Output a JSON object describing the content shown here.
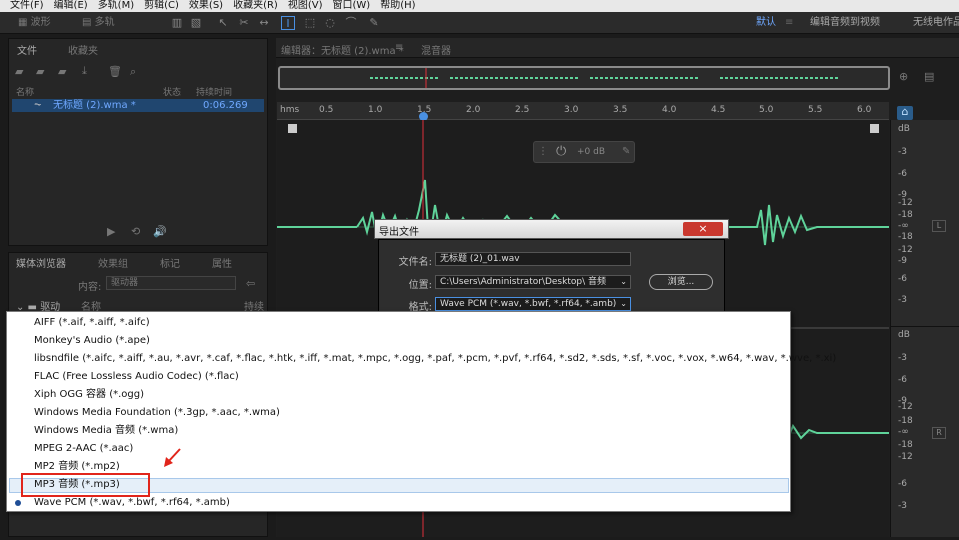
{
  "menu": [
    "文件(F)",
    "编辑(E)",
    "多轨(M)",
    "剪辑(C)",
    "效果(S)",
    "收藏夹(R)",
    "视图(V)",
    "窗口(W)",
    "帮助(H)"
  ],
  "toolbar": {
    "waveform_label": "波形",
    "multitrack_label": "多轨"
  },
  "workspace": {
    "default_label": "默认",
    "edit_video_label": "编辑音频到视频",
    "wireless_label": "无线电作品"
  },
  "files_panel": {
    "tabs": [
      "文件",
      "收藏夹"
    ],
    "columns": {
      "name": "名称",
      "status": "状态",
      "duration": "持续时间"
    },
    "file": {
      "name": "无标题 (2).wma *",
      "duration": "0:06.269"
    }
  },
  "media_panel": {
    "tabs": [
      "媒体浏览器",
      "效果组",
      "标记",
      "属性"
    ],
    "content_label": "内容:",
    "content_value": "驱动器",
    "drive_label": "驱动",
    "name_col": "名称",
    "duration_col": "持续"
  },
  "editor": {
    "tab_title": "编辑器：无标题 (2).wma *",
    "mixer_tab": "混音器",
    "ruler_unit": "hms",
    "ticks": [
      "0.5",
      "1.0",
      "1.5",
      "2.0",
      "2.5",
      "3.0",
      "3.5",
      "4.0",
      "4.5",
      "5.0",
      "5.5",
      "6.0"
    ],
    "volume_label": "+0 dB",
    "db_unit": "dB",
    "db_top": [
      "-3",
      "-6",
      "-9",
      "-12",
      "-18",
      "-∞",
      "-18",
      "-12",
      "-9",
      "-6",
      "-3"
    ],
    "db_bottom": [
      "-3",
      "-6",
      "-9",
      "-12",
      "-18",
      "-∞",
      "-18",
      "-12",
      "-6",
      "-3"
    ],
    "channel_l": "L",
    "channel_r": "R"
  },
  "dialog": {
    "title": "导出文件",
    "close": "×",
    "filename_label": "文件名:",
    "filename": "无标题 (2)_01.wav",
    "location_label": "位置:",
    "location": "C:\\Users\\Administrator\\Desktop\\ 音频",
    "browse_label": "浏览...",
    "format_label": "格式:",
    "format": "Wave PCM (*.wav, *.bwf, *.rf64, *.amb)"
  },
  "dropdown": {
    "options": [
      "AIFF (*.aif, *.aiff, *.aifc)",
      "Monkey's Audio (*.ape)",
      "libsndfile (*.aifc, *.aiff, *.au, *.avr, *.caf, *.flac, *.htk, *.iff, *.mat, *.mpc, *.ogg, *.paf, *.pcm, *.pvf, *.rf64, *.sd2, *.sds, *.sf, *.voc, *.vox, *.w64, *.wav, *.wve, *.xi)",
      "FLAC (Free Lossless Audio Codec) (*.flac)",
      "Xiph OGG 容器 (*.ogg)",
      "Windows Media Foundation (*.3gp, *.aac, *.wma)",
      "Windows Media 音频 (*.wma)",
      "MPEG 2-AAC (*.aac)",
      "MP2 音频 (*.mp2)",
      "MP3 音频 (*.mp3)",
      "Wave PCM (*.wav, *.bwf, *.rf64, *.amb)"
    ],
    "highlighted_index": 9,
    "current_index": 10
  },
  "colors": {
    "waveform": "#5fd39a",
    "playhead": "#e0303a",
    "highlight": "#e1251b",
    "accent": "#4a90e2"
  }
}
